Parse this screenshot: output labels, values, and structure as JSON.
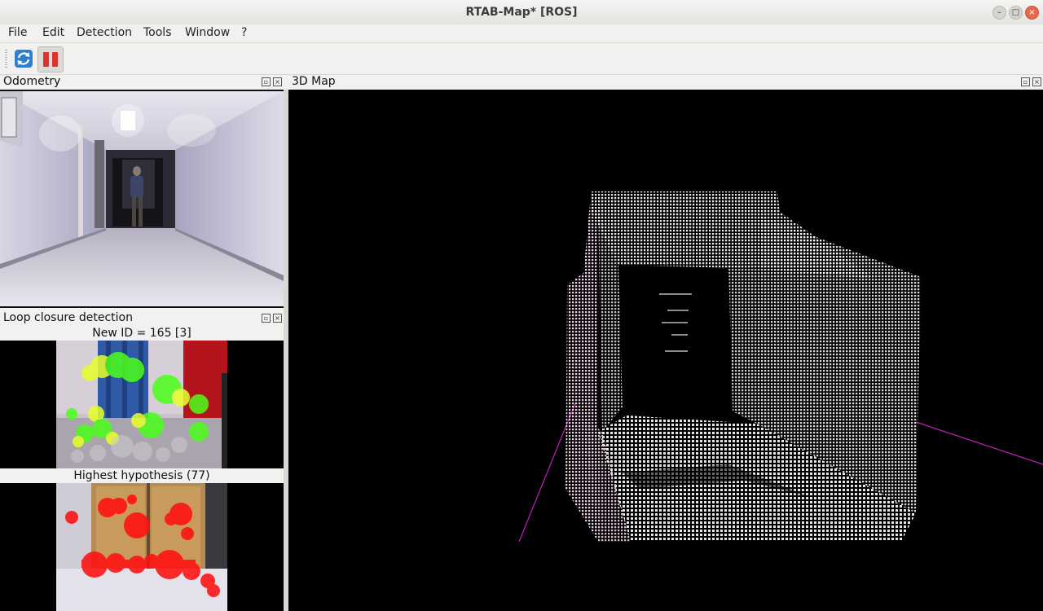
{
  "window": {
    "title": "RTAB-Map* [ROS]",
    "minimize_glyph": "–",
    "maximize_glyph": "□",
    "close_glyph": "×"
  },
  "menu": [
    "File",
    "Edit",
    "Detection",
    "Tools",
    "Window",
    "?"
  ],
  "toolbar": {
    "refresh_icon": "refresh-icon",
    "pause_icon": "pause-icon",
    "pause_color": "#e0322a"
  },
  "docks": {
    "odometry": {
      "title": "Odometry"
    },
    "loop_closure": {
      "title": "Loop closure detection",
      "new_id_caption": "New ID = 165 [3]",
      "hypothesis_caption": "Highest hypothesis (77)"
    },
    "map3d": {
      "title": "3D Map"
    }
  },
  "colors": {
    "window_bg": "#f2f1f0",
    "viewer_bg": "#000000",
    "feature_green": "#4cff1a",
    "feature_yellow": "#e8ff2a",
    "feature_red": "#ff1010",
    "trajectory": "#c020c0",
    "close_button": "#e9674a"
  }
}
